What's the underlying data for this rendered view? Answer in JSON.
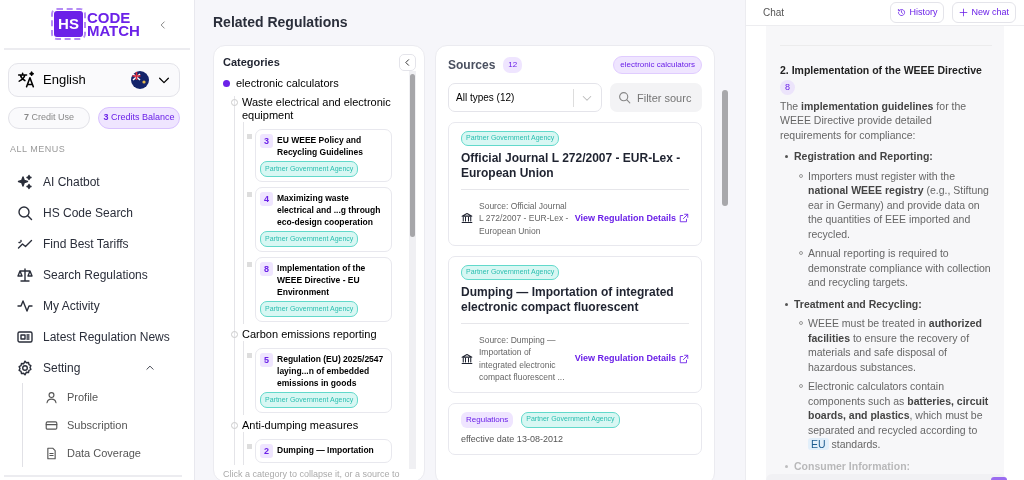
{
  "sidebar": {
    "logo": {
      "mark": "HS",
      "line1": "CODE",
      "line2": "MATCH"
    },
    "language": "English",
    "credits": [
      {
        "count": "7",
        "label": "Credit Use",
        "kind": "use"
      },
      {
        "count": "3",
        "label": "Credits Balance",
        "kind": "balance"
      }
    ],
    "section": "ALL MENUS",
    "menu": [
      {
        "label": "AI Chatbot"
      },
      {
        "label": "HS Code Search"
      },
      {
        "label": "Find Best Tariffs"
      },
      {
        "label": "Search Regulations"
      },
      {
        "label": "My Activity"
      },
      {
        "label": "Latest Regulation News"
      },
      {
        "label": "Setting",
        "expanded": true,
        "children": [
          {
            "label": "Profile"
          },
          {
            "label": "Subscription"
          },
          {
            "label": "Data Coverage"
          }
        ]
      }
    ]
  },
  "title": "Related Regulations",
  "categories": {
    "heading": "Categories",
    "root": {
      "label": "electronic calculators",
      "selected": true,
      "children": [
        {
          "label": "Waste electrical and electronic equipment",
          "children": [
            {
              "number": "3",
              "title": "EU WEEE Policy and Recycling Guidelines",
              "tag": "Partner Government Agency"
            },
            {
              "number": "4",
              "title": "Maximizing waste electrical and ...g through eco-design cooperation",
              "tag": "Partner Government Agency"
            },
            {
              "number": "8",
              "title": "Implementation of the WEEE Directive - EU Environment",
              "tag": "Partner Government Agency"
            }
          ]
        },
        {
          "label": "Carbon emissions reporting",
          "children": [
            {
              "number": "5",
              "title": "Regulation (EU) 2025/2547 laying...n of embedded emissions in goods",
              "tag": "Partner Government Agency"
            }
          ]
        },
        {
          "label": "Anti-dumping measures",
          "children": [
            {
              "number": "2",
              "title": "Dumping — Importation"
            }
          ]
        }
      ]
    },
    "hint": "Click a category to collapse it, or a source to"
  },
  "sources": {
    "heading": "Sources",
    "count": "12",
    "filter": "electronic calculators",
    "type_select": "All types (12)",
    "search": {
      "placeholder": "Filter sourc"
    },
    "cards": [
      {
        "tags": [
          {
            "label": "Partner Government Agency",
            "kind": "agency"
          }
        ],
        "title": "Official Journal L 272/2007 - EUR-Lex - European Union",
        "source": "Source: Official Journal L 272/2007 - EUR-Lex - European Union",
        "link": "View Regulation Details"
      },
      {
        "tags": [
          {
            "label": "Partner Government Agency",
            "kind": "agency"
          }
        ],
        "title": "Dumping — Importation of integrated electronic compact fluorescent",
        "source": "Source: Dumping — Importation of integrated electronic compact fluorescent ...",
        "link": "View Regulation Details"
      },
      {
        "tags": [
          {
            "label": "Regulations",
            "kind": "regulation"
          },
          {
            "label": "Partner Government Agency",
            "kind": "agency"
          }
        ],
        "effective": "effective date 13-08-2012"
      }
    ]
  },
  "chat": {
    "title": "Chat",
    "buttons": [
      {
        "label": "History",
        "kind": "history"
      },
      {
        "label": "New chat",
        "kind": "new"
      }
    ],
    "heading": "2. Implementation of the WEEE Directive",
    "citation": "8",
    "intro": "The **implementation guidelines** for the WEEE Directive provide detailed requirements for compliance:",
    "bullets": [
      {
        "label": "Registration and Reporting:",
        "faded": false,
        "children": [
          {
            "text": "Importers must register with the **national WEEE registry** (e.g., Stiftung ear in Germany) and provide data on the quantities of EEE imported and recycled."
          },
          {
            "text": "Annual reporting is required to demonstrate compliance with collection and recycling targets."
          }
        ]
      },
      {
        "label": "Treatment and Recycling:",
        "faded": false,
        "children": [
          {
            "text": "WEEE must be treated in **authorized facilities** to ensure the recovery of materials and safe disposal of hazardous substances."
          },
          {
            "text": "Electronic calculators contain components such as **batteries, circuit boards, and plastics**, which must be separated and recycled according to",
            "term": "EU",
            "after": "standards."
          }
        ]
      },
      {
        "label": "Consumer Information:",
        "faded": true
      }
    ]
  }
}
